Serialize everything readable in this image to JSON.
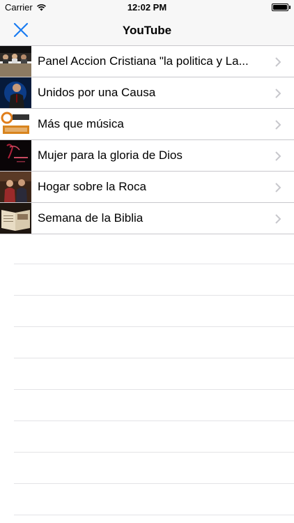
{
  "status_bar": {
    "carrier": "Carrier",
    "time": "12:02 PM",
    "wifi_icon": "wifi-icon",
    "battery_icon": "battery-icon"
  },
  "nav": {
    "title": "YouTube",
    "close_icon": "close-icon",
    "tint_color": "#1a7cf2"
  },
  "rows": [
    {
      "label": "Panel Accion Cristiana \"la politica y La...",
      "thumb_icon": "panel-thumbnail"
    },
    {
      "label": "Unidos por una Causa",
      "thumb_icon": "unidos-thumbnail"
    },
    {
      "label": "Más que música",
      "thumb_icon": "mas-que-musica-thumbnail"
    },
    {
      "label": "Mujer para la gloria de Dios",
      "thumb_icon": "mujer-thumbnail"
    },
    {
      "label": "Hogar sobre la Roca",
      "thumb_icon": "hogar-thumbnail"
    },
    {
      "label": "Semana de la Biblia",
      "thumb_icon": "semana-thumbnail"
    }
  ]
}
